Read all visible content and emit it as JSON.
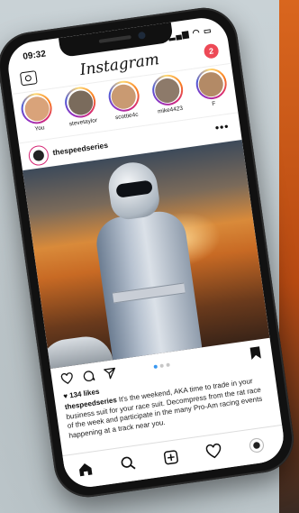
{
  "status": {
    "time": "09:32"
  },
  "app": {
    "logo": "Instagram",
    "notification_count": "2"
  },
  "stories": [
    {
      "name": "You",
      "color": "#d9a37a"
    },
    {
      "name": "stevetaylor",
      "color": "#7a6b5c"
    },
    {
      "name": "scottie4c",
      "color": "#c99a72"
    },
    {
      "name": "mike4423",
      "color": "#8d7a6a"
    },
    {
      "name": "F",
      "color": "#b38a66"
    }
  ],
  "post": {
    "username": "thespeedseries",
    "more_label": "•••",
    "likes": "♥ 134 likes",
    "caption_user": "thespeedseries",
    "caption_text": " It's the weekend, AKA time to trade in your business suit for your race suit. Decompress from the rat race of the week and participate in the many Pro-Am racing events happening at a track near you."
  },
  "carousel": {
    "count": 3,
    "active_index": 0
  },
  "icons": {
    "camera": "camera-icon",
    "heart": "heart-icon",
    "comment": "comment-icon",
    "share": "share-icon",
    "bookmark": "bookmark-icon",
    "home": "home-icon",
    "search": "search-icon",
    "add": "add-post-icon",
    "activity": "activity-heart-icon",
    "profile": "profile-icon"
  }
}
